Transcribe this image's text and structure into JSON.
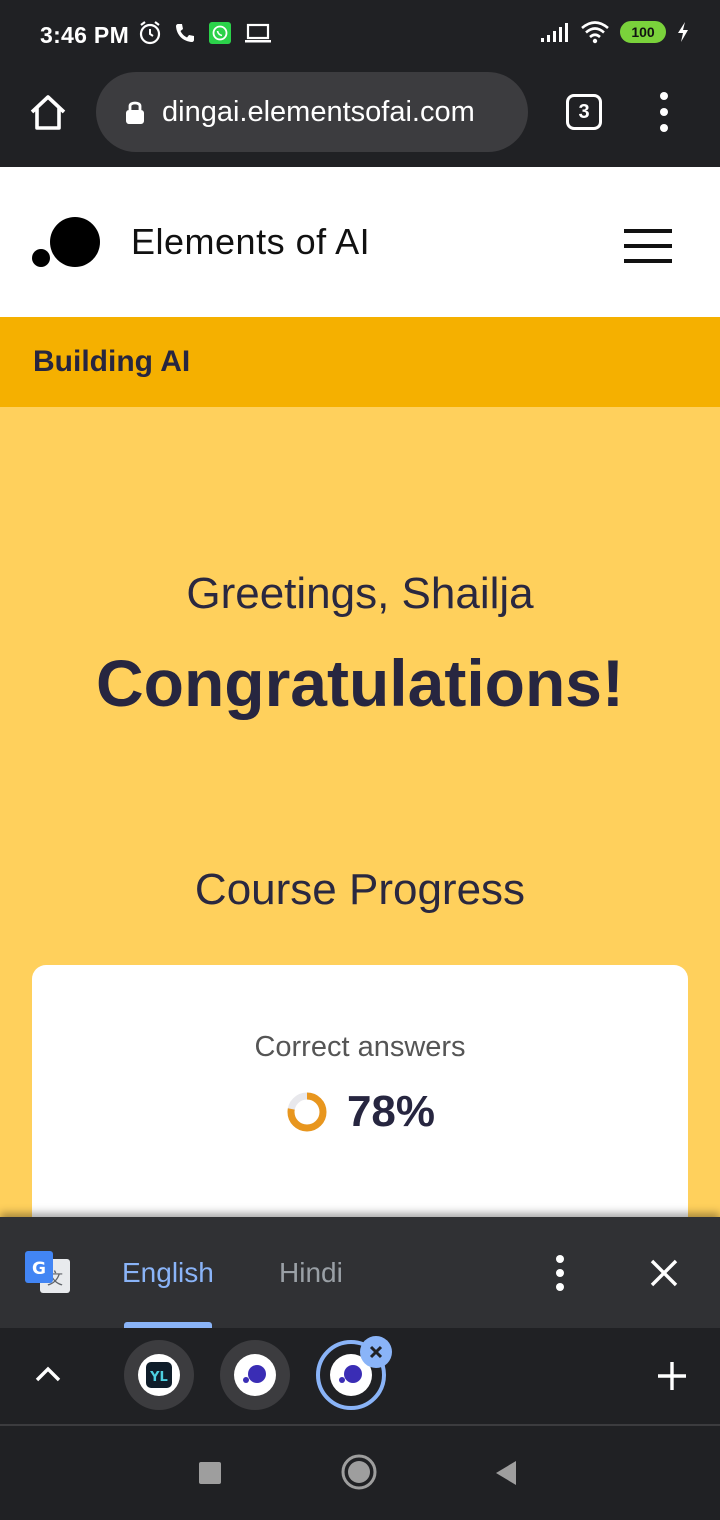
{
  "status_bar": {
    "time": "3:46 PM",
    "battery": "100",
    "icons": [
      "alarm-icon",
      "phone-icon",
      "whatsapp-icon",
      "laptop-icon",
      "signal-icon",
      "wifi-icon",
      "battery-icon",
      "charging-icon"
    ]
  },
  "browser": {
    "url": "dingai.elementsofai.com",
    "tab_count": "3"
  },
  "site": {
    "title": "Elements of AI"
  },
  "course": {
    "name": "Building AI"
  },
  "main": {
    "greeting": "Greetings, Shailja",
    "congrats": "Congratulations!",
    "progress_heading": "Course Progress",
    "card": {
      "label": "Correct answers",
      "value": "78%",
      "fraction": 0.78
    }
  },
  "translate": {
    "lang_active": "English",
    "lang_other": "Hindi"
  },
  "colors": {
    "accent_orange": "#e8961e",
    "banner": "#f5b000",
    "main_bg": "#ffd05c",
    "text_dark": "#272640",
    "translate_blue": "#8ab4f8"
  }
}
